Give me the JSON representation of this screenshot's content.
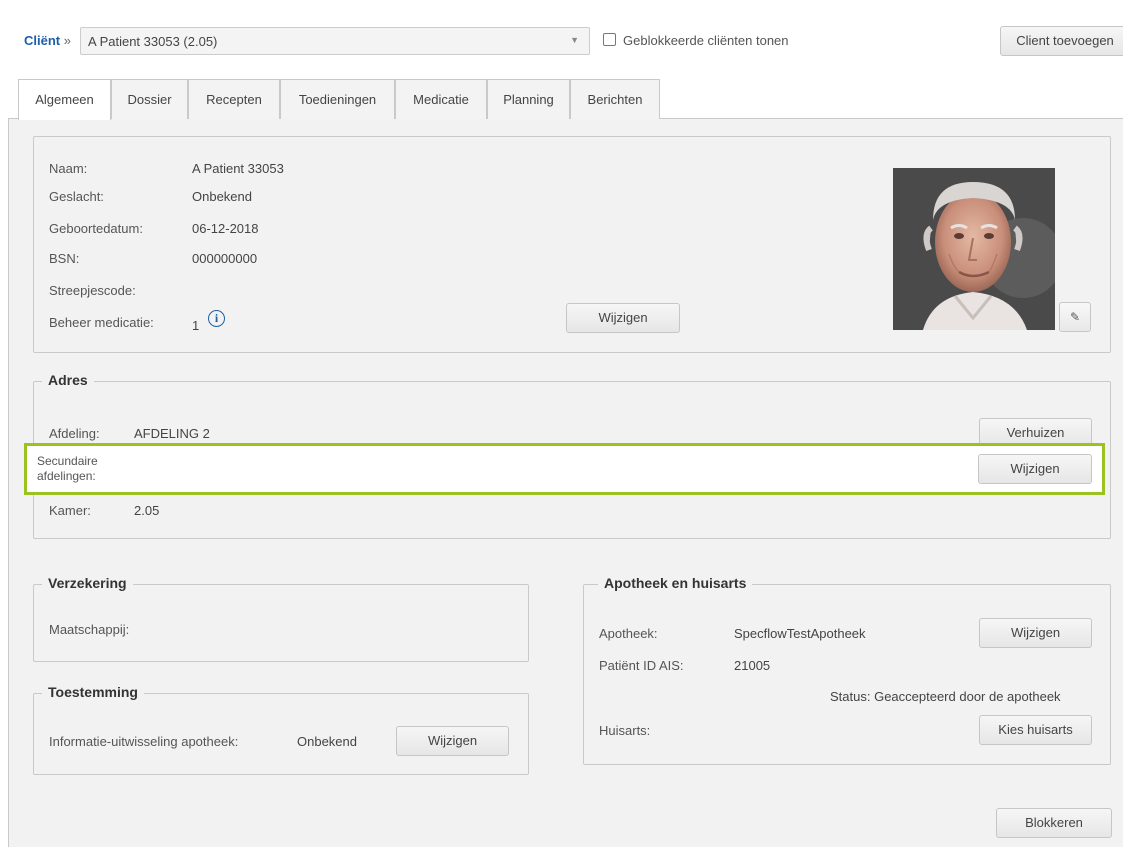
{
  "client_bar": {
    "label": "Cliënt",
    "crumb_sep": "»",
    "selected_client": "A Patient 33053 (2.05)",
    "show_blocked_label": "Geblokkeerde cliënten tonen",
    "add_client_label": "Client toevoegen"
  },
  "tabs": [
    {
      "label": "Algemeen",
      "active": true
    },
    {
      "label": "Dossier"
    },
    {
      "label": "Recepten"
    },
    {
      "label": "Toedieningen"
    },
    {
      "label": "Medicatie"
    },
    {
      "label": "Planning"
    },
    {
      "label": "Berichten"
    }
  ],
  "personal": {
    "fields": [
      {
        "label": "Naam:",
        "value": "A Patient 33053"
      },
      {
        "label": "Geslacht:",
        "value": "Onbekend"
      },
      {
        "label": "Geboortedatum:",
        "value": "06-12-2018"
      },
      {
        "label": "BSN:",
        "value": "000000000"
      },
      {
        "label": "Streepjescode:",
        "value": ""
      },
      {
        "label": "Beheer medicatie:",
        "value": "1"
      }
    ],
    "edit_label": "Wijzigen"
  },
  "adres": {
    "title": "Adres",
    "afdeling_label": "Afdeling:",
    "afdeling_value": "AFDELING 2",
    "move_label": "Verhuizen",
    "secondary_label_1": "Secundaire",
    "secondary_label_2": "afdelingen:",
    "secondary_edit_label": "Wijzigen",
    "room_label": "Kamer:",
    "room_value": "2.05"
  },
  "verzekering": {
    "title": "Verzekering",
    "company_label": "Maatschappij:"
  },
  "toestemming": {
    "title": "Toestemming",
    "info_label": "Informatie-uitwisseling apotheek:",
    "info_value": "Onbekend",
    "edit_label": "Wijzigen"
  },
  "apotheek": {
    "title": "Apotheek en huisarts",
    "pharmacy_label": "Apotheek:",
    "pharmacy_value": "SpecflowTestApotheek",
    "edit_label": "Wijzigen",
    "patient_id_label": "Patiënt ID AIS:",
    "patient_id_value": "21005",
    "status_text": "Status: Geaccepteerd door de apotheek",
    "gp_label": "Huisarts:",
    "choose_gp_label": "Kies huisarts"
  },
  "footer": {
    "block_label": "Blokkeren"
  },
  "colors": {
    "highlight": "#9bc31f",
    "info_icon": "#1f5fa8"
  }
}
